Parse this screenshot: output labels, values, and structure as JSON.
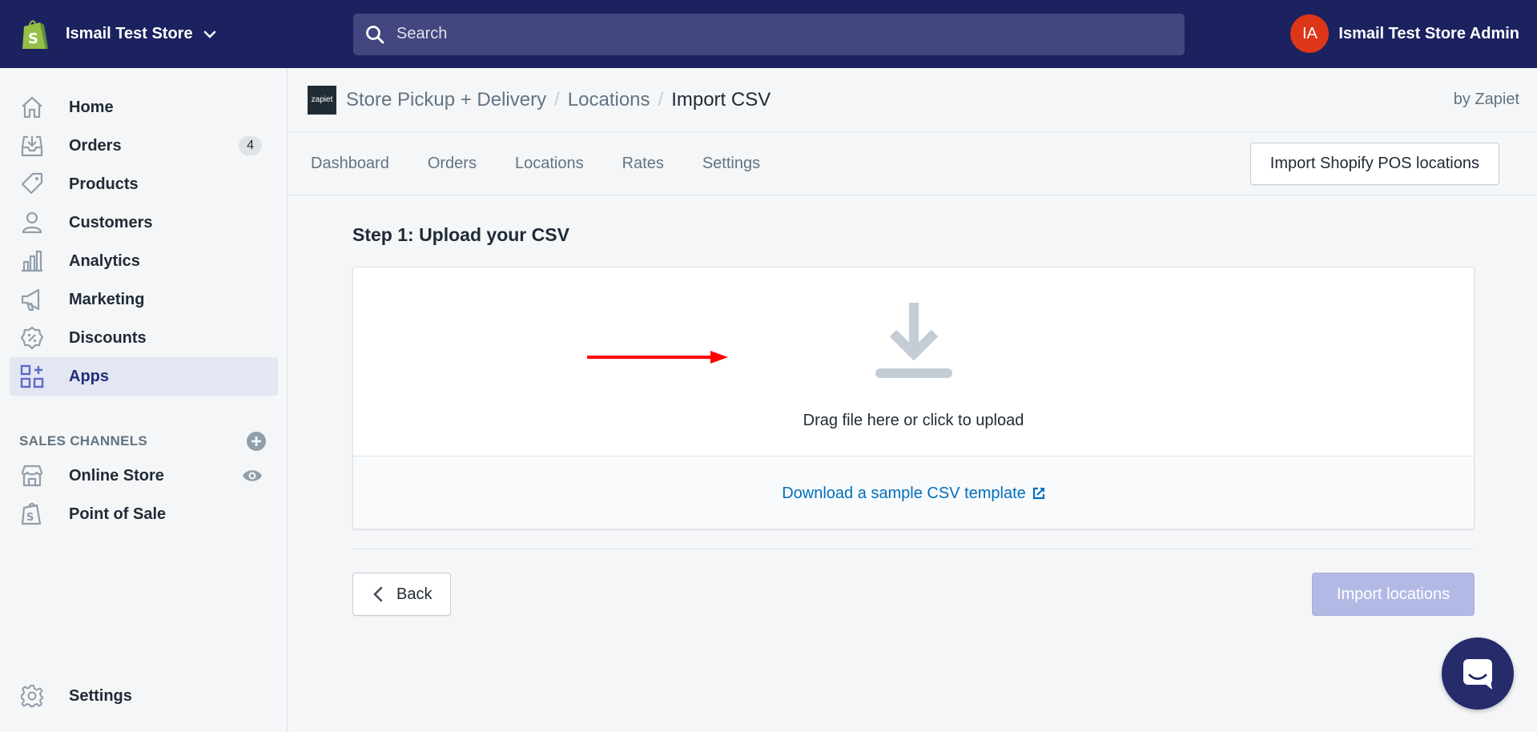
{
  "topbar": {
    "store_name": "Ismail Test Store",
    "search_placeholder": "Search",
    "admin_initials": "IA",
    "admin_name": "Ismail Test Store Admin"
  },
  "sidebar": {
    "items": [
      {
        "label": "Home",
        "icon": "home-icon"
      },
      {
        "label": "Orders",
        "icon": "orders-icon",
        "badge": "4"
      },
      {
        "label": "Products",
        "icon": "products-icon"
      },
      {
        "label": "Customers",
        "icon": "customers-icon"
      },
      {
        "label": "Analytics",
        "icon": "analytics-icon"
      },
      {
        "label": "Marketing",
        "icon": "marketing-icon"
      },
      {
        "label": "Discounts",
        "icon": "discounts-icon"
      },
      {
        "label": "Apps",
        "icon": "apps-icon",
        "active": true
      }
    ],
    "sales_channels_title": "SALES CHANNELS",
    "channels": [
      {
        "label": "Online Store",
        "icon": "online-store-icon"
      },
      {
        "label": "Point of Sale",
        "icon": "point-of-sale-icon"
      }
    ],
    "settings_label": "Settings"
  },
  "app_header": {
    "logo_text": "zapiet",
    "breadcrumb": [
      "Store Pickup + Delivery",
      "Locations"
    ],
    "separator": "/",
    "current": "Import CSV",
    "byline": "by Zapiet"
  },
  "tabs": [
    "Dashboard",
    "Orders",
    "Locations",
    "Rates",
    "Settings"
  ],
  "pos_button_label": "Import Shopify POS locations",
  "step_title": "Step 1: Upload your CSV",
  "dropzone_text": "Drag file here or click to upload",
  "download_link": "Download a sample CSV template",
  "back_label": "Back",
  "import_label": "Import locations",
  "colors": {
    "topbar": "#1c2260",
    "accent": "#5c6ac4",
    "link": "#006fbb",
    "disabled_primary": "#b3b9e5",
    "annotation_arrow": "#ff0000"
  }
}
